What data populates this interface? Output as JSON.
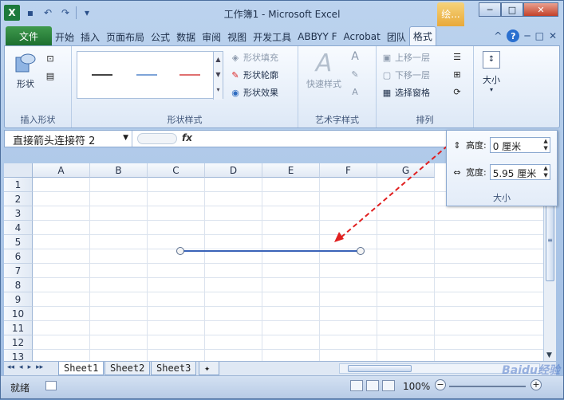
{
  "window": {
    "title": "工作簿1 - Microsoft Excel",
    "context_tab": "绘...",
    "btn_min": "─",
    "btn_max": "□",
    "btn_close": "✕"
  },
  "qat": {
    "undo": "↶",
    "redo": "↷",
    "more": "▾"
  },
  "tabs": {
    "file": "文件",
    "items": [
      "开始",
      "插入",
      "页面布局",
      "公式",
      "数据",
      "审阅",
      "视图",
      "开发工具",
      "ABBYY F",
      "Acrobat",
      "团队",
      "格式"
    ],
    "active": "格式",
    "right_icons": [
      "^",
      "?",
      "─",
      "□",
      "✕"
    ]
  },
  "ribbon": {
    "insert_shapes": {
      "label": "插入形状",
      "shapes_button": "形状"
    },
    "shape_styles": {
      "label": "形状样式",
      "fill": "形状填充",
      "outline": "形状轮廓",
      "effect": "形状效果",
      "swatches": [
        "#444444",
        "#7ea4d8",
        "#e07070"
      ]
    },
    "art_styles": {
      "label": "艺术字样式",
      "quick": "快速样式"
    },
    "arrange": {
      "label": "排列",
      "bring_forward": "上移一层",
      "send_backward": "下移一层",
      "selection_pane": "选择窗格"
    },
    "size": {
      "label": "大小"
    }
  },
  "formula_bar": {
    "name_box": "直接箭头连接符 2",
    "fx": "fx"
  },
  "sheet": {
    "columns": [
      "A",
      "B",
      "C",
      "D",
      "E",
      "F",
      "G"
    ],
    "rows": [
      "1",
      "2",
      "3",
      "4",
      "5",
      "6",
      "7",
      "8",
      "9",
      "10",
      "11",
      "12",
      "13"
    ],
    "line_color": "#3a63b8",
    "arrow_color": "#e02020"
  },
  "sheet_tabs": {
    "nav": [
      "◂◂",
      "◂",
      "▸",
      "▸▸"
    ],
    "tabs": [
      "Sheet1",
      "Sheet2",
      "Sheet3"
    ],
    "active": "Sheet1"
  },
  "status": {
    "ready": "就绪",
    "zoom": "100%",
    "zoom_minus": "−",
    "zoom_plus": "+"
  },
  "size_popup": {
    "height_label": "高度:",
    "height_value": "0 厘米",
    "width_label": "宽度:",
    "width_value": "5.95 厘米",
    "label": "大小"
  },
  "watermark": "Baidu经验"
}
